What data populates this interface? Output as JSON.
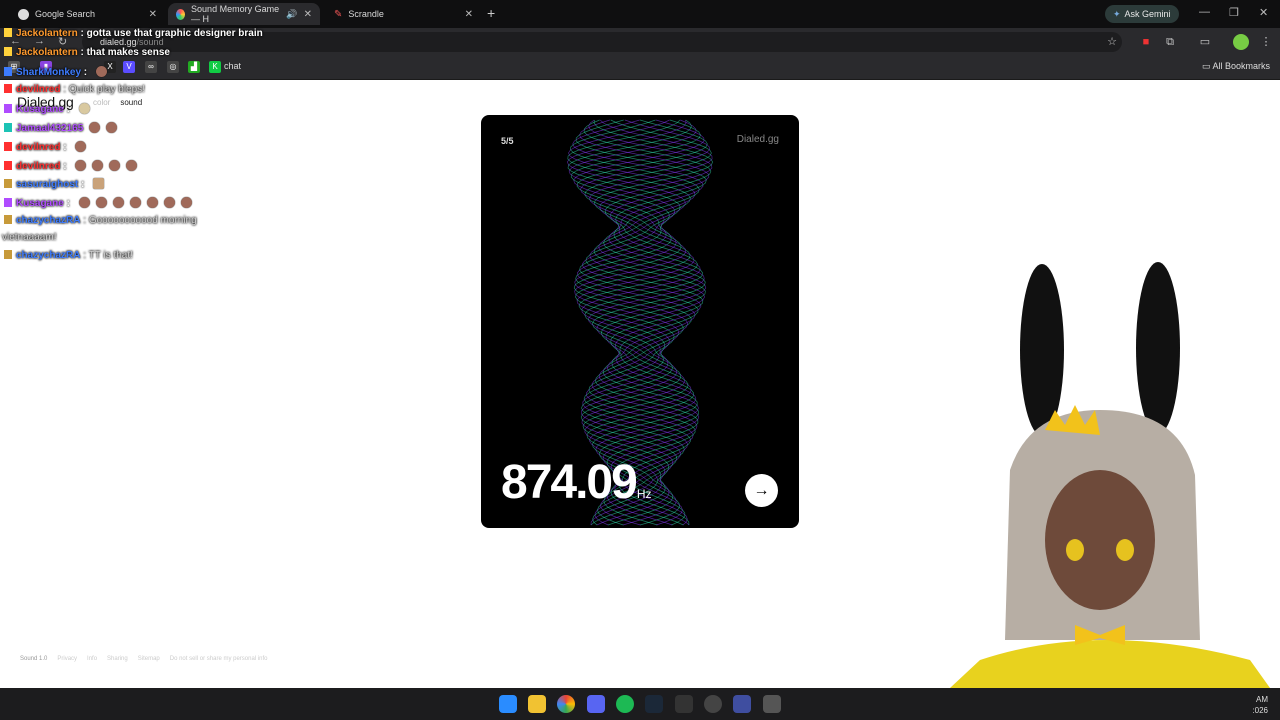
{
  "browser": {
    "tabs": [
      {
        "title": "Google Search",
        "active": false
      },
      {
        "title": "Sound Memory Game — H",
        "active": true
      },
      {
        "title": "Scrandle",
        "active": false
      }
    ],
    "ask_gemini": "Ask Gemini",
    "url_domain": "dialed.gg",
    "url_path": "/sound",
    "bookmarks_label": "chat",
    "all_bookmarks": "All Bookmarks"
  },
  "site": {
    "logo": "Dialed.gg",
    "nav": [
      "color",
      "sound"
    ],
    "card": {
      "counter": "5/5",
      "brand": "Dialed.gg",
      "frequency": "874.09",
      "unit": "Hz",
      "next_icon": "arrow-right-icon"
    },
    "footer": [
      "Sound 1.0",
      "Privacy",
      "Info",
      "Sharing",
      "Sitemap",
      "Do not sell or share my personal info"
    ]
  },
  "chat": [
    {
      "user": "Jackolantern",
      "text": "gotta use that graphic designer brain",
      "color": "#ff9a2e"
    },
    {
      "user": "Jackolantern",
      "text": "that makes sense",
      "color": "#ff9a2e"
    },
    {
      "user": "SharkMonkey",
      "text": "",
      "color": "#3d7cff"
    },
    {
      "user": "devilnred",
      "text": "Quick play bleps!",
      "color": "#ff3030"
    },
    {
      "user": "Kusagane",
      "text": "",
      "color": "#b04cff"
    },
    {
      "user": "Jamaal432165",
      "text": "",
      "color": "#b04cff"
    },
    {
      "user": "devilnred",
      "text": "",
      "color": "#ff3030"
    },
    {
      "user": "devilnred",
      "text": "",
      "color": "#ff3030"
    },
    {
      "user": "sasuraighost",
      "text": "",
      "color": "#3d7cff"
    },
    {
      "user": "Kusagane",
      "text": "",
      "color": "#b04cff"
    },
    {
      "user": "chazychazRA",
      "text": "Gooooooooood morning",
      "color": "#3d7cff"
    },
    {
      "user": "",
      "text": "vietnaaaam!",
      "color": "#ffffff"
    },
    {
      "user": "chazychazRA",
      "text": "TT is that!",
      "color": "#3d7cff"
    }
  ],
  "taskbar": {
    "clock_time": "AM",
    "clock_date": ":026"
  },
  "colors": {
    "wave_teal": "#33e0b0",
    "wave_purple": "#8a3cff"
  }
}
